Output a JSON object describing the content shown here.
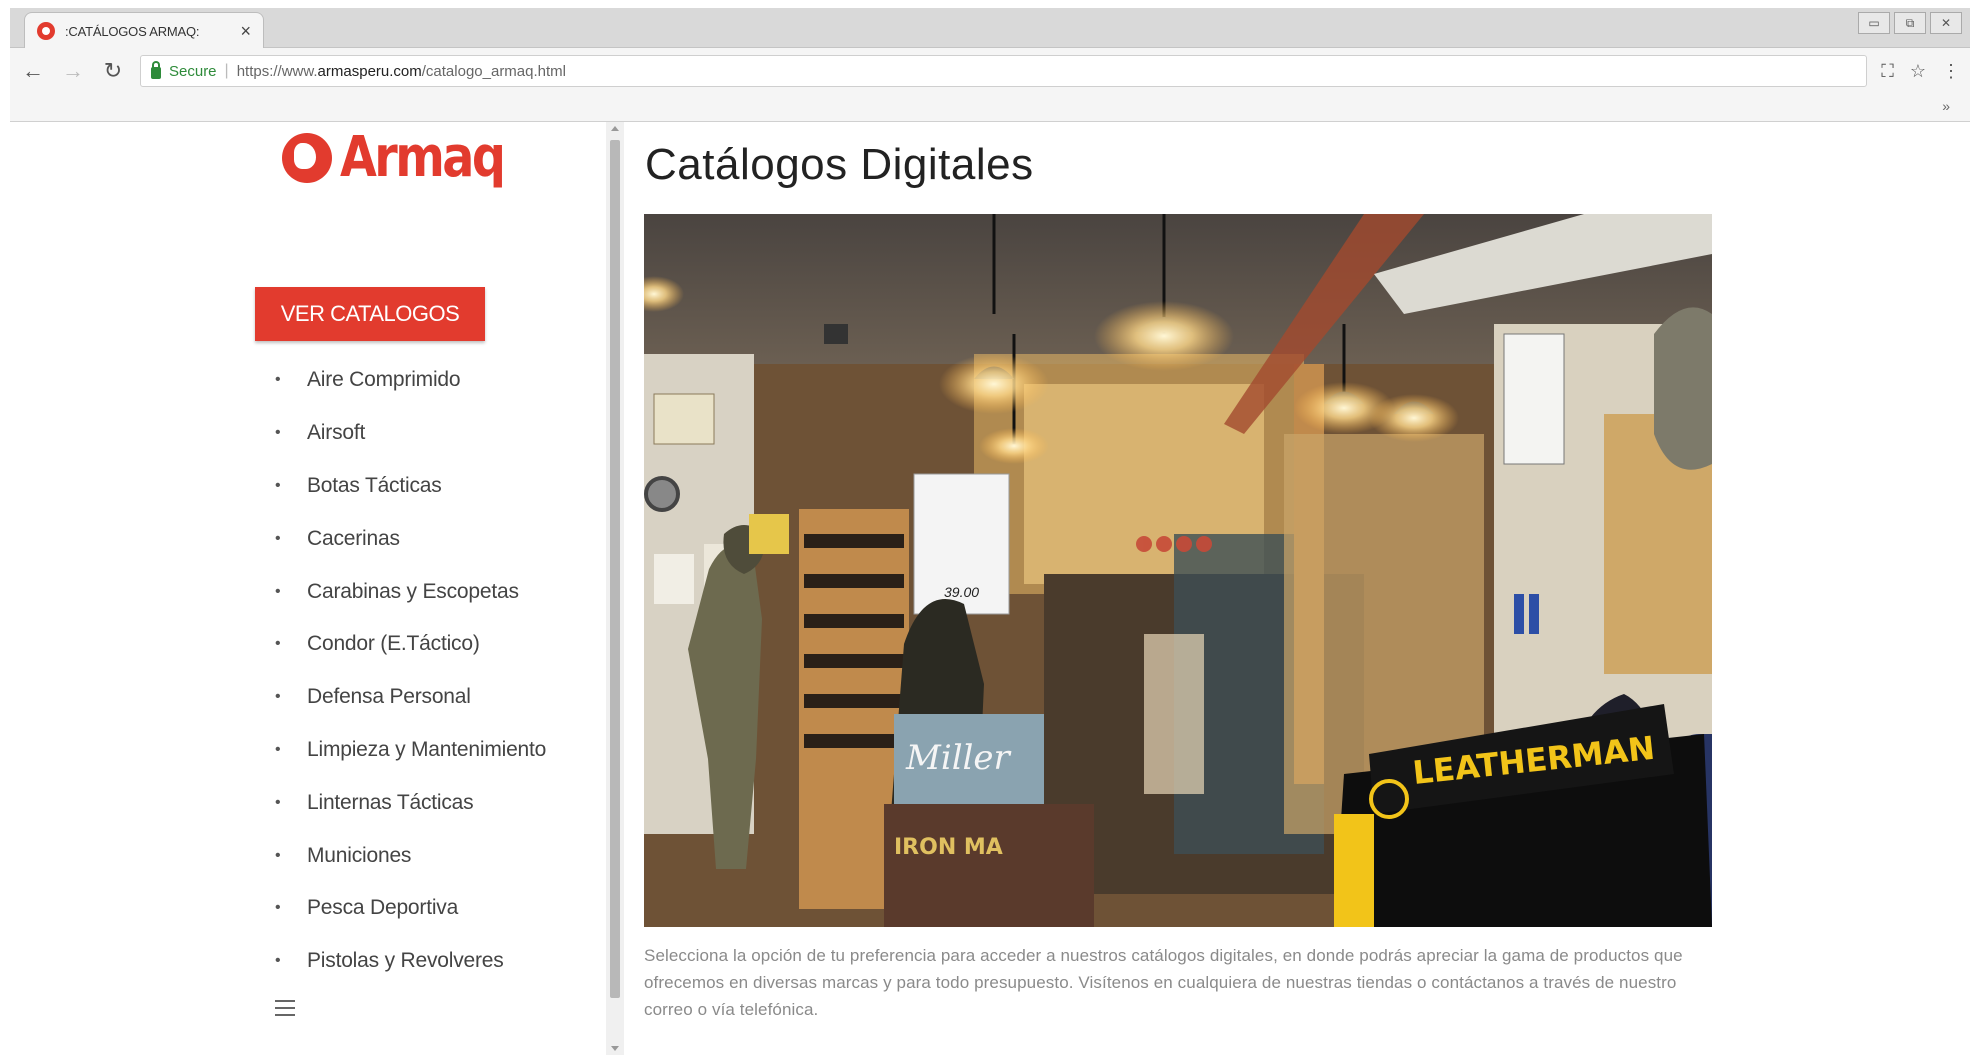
{
  "browser": {
    "tab_title": ":CATÁLOGOS ARMAQ:",
    "tab_close": "×",
    "secure_label": "Secure",
    "url_prefix": "https://www.",
    "url_domain": "armasperu.com",
    "url_path": "/catalogo_armaq.html",
    "more_bookmarks": "»"
  },
  "sidebar": {
    "logo_text": "Armaq",
    "cta_button": "VER CATALOGOS",
    "categories": [
      "Aire Comprimido",
      "Airsoft",
      "Botas Tácticas",
      "Cacerinas",
      "Carabinas y Escopetas",
      "Condor (E.Táctico)",
      "Defensa Personal",
      "Limpieza y Mantenimiento",
      "Linternas Tácticas",
      "Municiones",
      "Pesca Deportiva",
      "Pistolas y Revolveres"
    ]
  },
  "main": {
    "title": "Catálogos Digitales",
    "photo_signs": {
      "price": "39.00",
      "miller": "Miller",
      "leatherman": "LEATHERMAN",
      "ironman": "IRON MA"
    },
    "description": "Selecciona la opción de tu preferencia para acceder a nuestros catálogos digitales, en donde podrás apreciar la gama de productos que ofrecemos en diversas marcas y para todo presupuesto. Visítenos en cualquiera de nuestras tiendas o contáctanos a través de nuestro correo o vía telefónica."
  },
  "colors": {
    "brand_red": "#e23b2e",
    "text_gray": "#8a8a8a",
    "secure_green": "#2e8b3a"
  }
}
